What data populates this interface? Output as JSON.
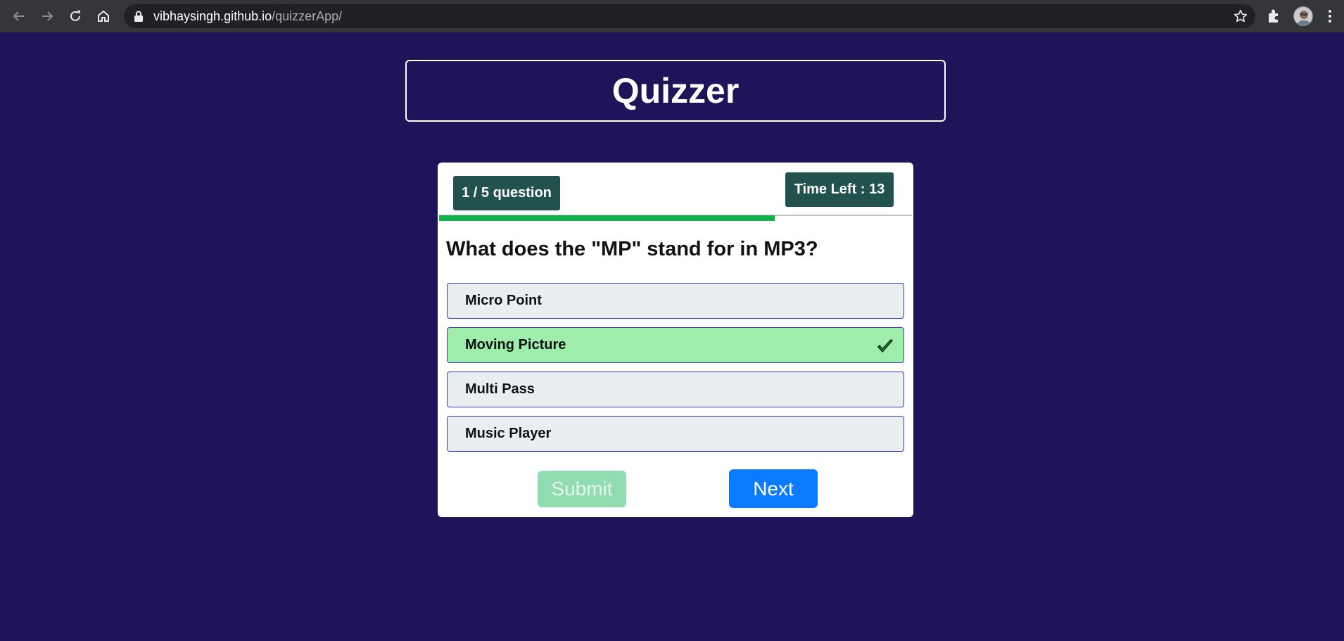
{
  "browser": {
    "url_domain": "vibhaysingh.github.io",
    "url_path": "/quizzerApp/"
  },
  "app": {
    "title": "Quizzer"
  },
  "quiz": {
    "question_counter": "1 / 5 question",
    "timer_text": "Time Left : 13",
    "progress_fraction": 0.71,
    "question": "What does the \"MP\" stand for in MP3?",
    "options": [
      {
        "label": "Micro Point",
        "state": "default"
      },
      {
        "label": "Moving Picture",
        "state": "correct"
      },
      {
        "label": "Multi Pass",
        "state": "default"
      },
      {
        "label": "Music Player",
        "state": "default"
      }
    ],
    "submit_label": "Submit",
    "submit_disabled": true,
    "next_label": "Next"
  },
  "colors": {
    "page_background": "#1f135a",
    "badge": "#22524d",
    "progress": "#16b14f",
    "correct_option": "#9fedaa",
    "next_button": "#0a7bff"
  }
}
